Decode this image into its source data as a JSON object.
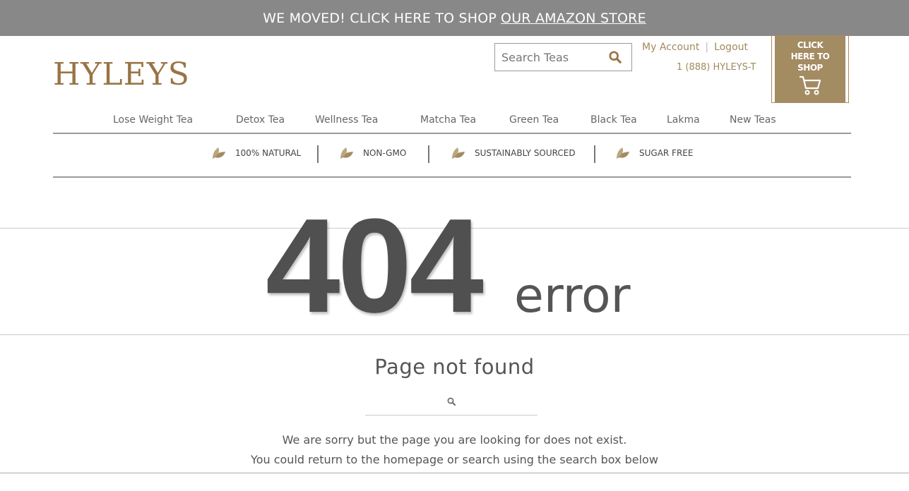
{
  "banner": {
    "text": "WE MOVED! CLICK HERE TO SHOP",
    "link": "OUR AMAZON STORE"
  },
  "logo": "HYLEYS",
  "header": {
    "search_placeholder": "Search Teas",
    "my_account": "My Account",
    "logout": "Logout",
    "phone": "1 (888) HYLEYS-T",
    "shop_badge": [
      "CLICK",
      "HERE TO",
      "SHOP"
    ]
  },
  "nav": {
    "items": [
      {
        "label": "Lose Weight Tea"
      },
      {
        "label": "Detox Tea"
      },
      {
        "label": "Wellness Tea"
      },
      {
        "label": "Matcha Tea"
      },
      {
        "label": "Green Tea"
      },
      {
        "label": "Black Tea"
      },
      {
        "label": "Lakma"
      },
      {
        "label": "New Teas"
      }
    ]
  },
  "features": [
    {
      "label": "100% NATURAL",
      "icon": "leaf-icon"
    },
    {
      "label": "NON-GMO",
      "icon": "leaf-icon"
    },
    {
      "label": "SUSTAINABLY SOURCED",
      "icon": "leaf-icon"
    },
    {
      "label": "SUGAR FREE",
      "icon": "leaf-icon"
    }
  ],
  "error": {
    "code": "404",
    "word": "error",
    "title": "Page not found",
    "line1": "We are sorry but the page you are looking for does not exist.",
    "line2": "You could return to the homepage or search using the search box below"
  },
  "colors": {
    "banner": "#888888",
    "brand": "#9a7445",
    "accent": "#a38b62",
    "text": "#555555"
  }
}
